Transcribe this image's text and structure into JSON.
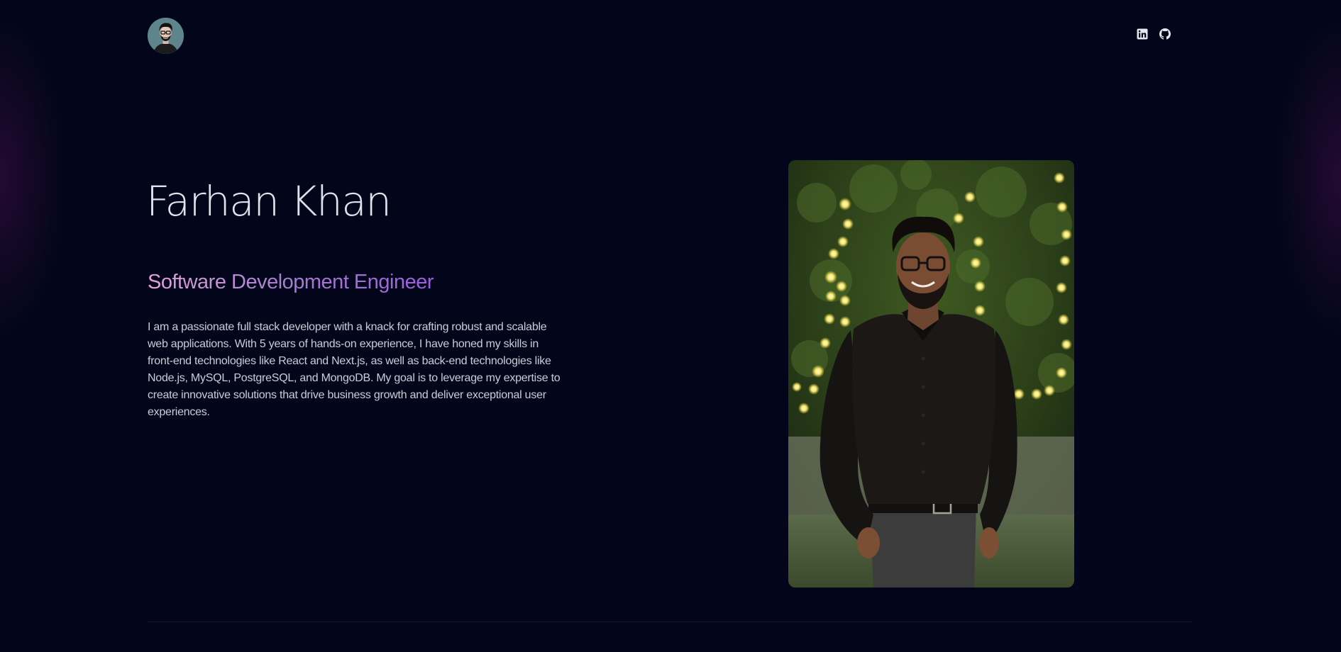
{
  "header": {
    "avatar_icon": "avatar-illustration",
    "social": [
      {
        "name": "LinkedIn",
        "icon": "linkedin-icon"
      },
      {
        "name": "GitHub",
        "icon": "github-icon"
      }
    ]
  },
  "hero": {
    "name": "Farhan Khan",
    "role": "Software Development Engineer",
    "bio": "I am a passionate full stack developer with a knack for crafting robust and scalable web applications. With 5 years of hands-on experience, I have honed my skills in front-end technologies like React and Next.js, as well as back-end technologies like Node.js, MySQL, PostgreSQL, and MongoDB. My goal is to leverage my expertise to create innovative solutions that drive business growth and deliver exceptional user experiences."
  },
  "colors": {
    "background": "#03061a",
    "text": "#dfe3ec",
    "gradient_start": "#e7a3da",
    "gradient_end": "#9b5fdc"
  }
}
